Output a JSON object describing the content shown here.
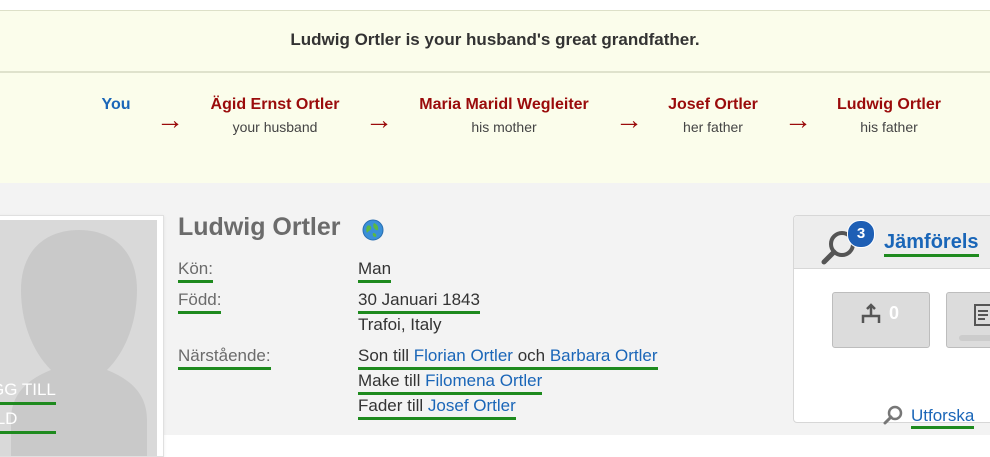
{
  "relationship": {
    "statement": "Ludwig Ortler is your husband's great grandfather.",
    "chain": [
      {
        "name": "You",
        "role": ""
      },
      {
        "name": "Ägid Ernst Ortler",
        "role": "your husband"
      },
      {
        "name": "Maria Maridl Wegleiter",
        "role": "his mother"
      },
      {
        "name": "Josef Ortler",
        "role": "her father"
      },
      {
        "name": "Ludwig Ortler",
        "role": "his father"
      }
    ],
    "arrow_glyph": "→"
  },
  "photo": {
    "add_label_line1": "GG TILL",
    "add_label_line2": "ILD"
  },
  "person": {
    "name": "Ludwig Ortler",
    "facts": {
      "gender_label": "Kön:",
      "gender_value": "Man",
      "born_label": "Född:",
      "born_date": "30 Januari 1843",
      "born_place": "Trafoi, Italy",
      "relatives_label": "Närstående:",
      "son_of_prefix": "Son till",
      "father_name": "Florian Ortler",
      "and_word": "och",
      "mother_name": "Barbara Ortler",
      "husband_of_prefix": "Make till",
      "spouse_name": "Filomena Ortler",
      "father_of_prefix": "Fader till",
      "child_name": "Josef Ortler"
    }
  },
  "compare_panel": {
    "title": "Jämförels",
    "badge_count": "3",
    "tree_button_count": "0",
    "explore_link": "Utforska"
  },
  "colors": {
    "banner_bg": "#fbfdeb",
    "relative_name": "#9a0b0b",
    "you_link": "#1a66b8",
    "underline_green": "#1e8a1e",
    "badge_blue": "#1e5fb5"
  }
}
